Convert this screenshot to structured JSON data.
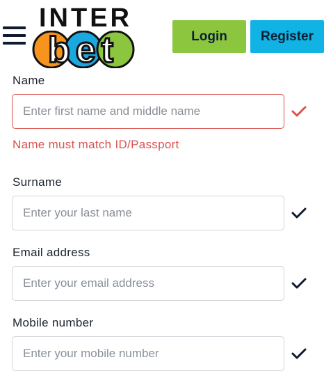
{
  "header": {
    "brand_top": "INTER",
    "brand_bottom": "bet",
    "login_label": "Login",
    "register_label": "Register"
  },
  "form": {
    "name": {
      "label": "Name",
      "placeholder": "Enter first name and middle name",
      "value": "",
      "error": "Name must match ID/Passport",
      "status": "invalid"
    },
    "surname": {
      "label": "Surname",
      "placeholder": "Enter your last name",
      "value": "",
      "status": "valid"
    },
    "email": {
      "label": "Email address",
      "placeholder": "Enter your email address",
      "value": "",
      "status": "valid"
    },
    "mobile": {
      "label": "Mobile number",
      "placeholder": "Enter your mobile number",
      "value": "",
      "status": "valid"
    }
  },
  "icons": {
    "menu": "hamburger-menu-icon",
    "check": "checkmark-icon"
  },
  "colors": {
    "login": "#8cc63f",
    "register": "#10b3e4",
    "error": "#d9534f",
    "check_valid": "#0f1b2e",
    "logo_orange": "#f7941d",
    "logo_blue": "#1ba8e0",
    "logo_green": "#8cc63f"
  }
}
